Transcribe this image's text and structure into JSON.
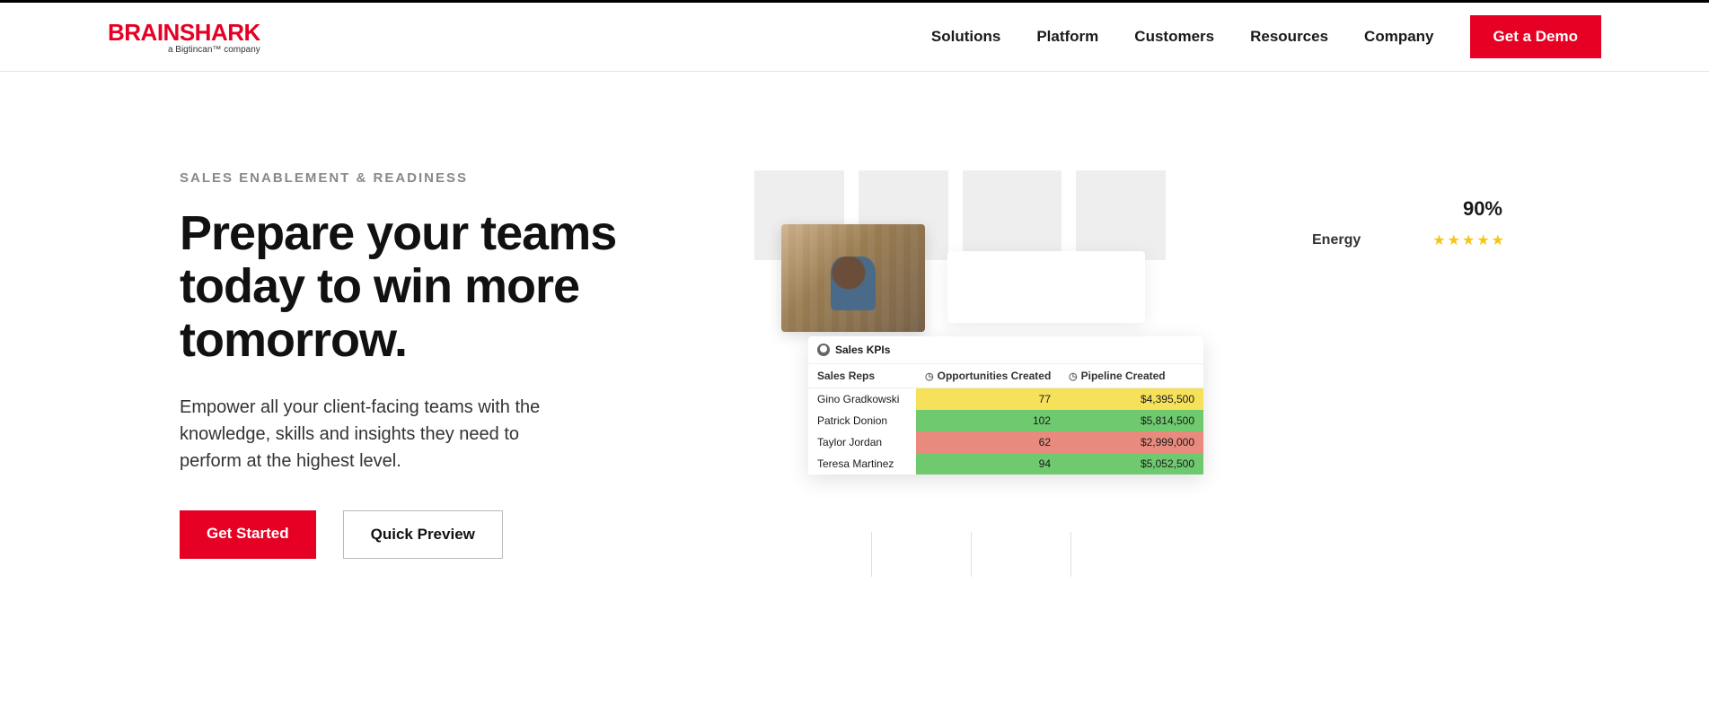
{
  "brand": {
    "name": "BRAINSHARK",
    "tagline": "a Bigtincan™ company"
  },
  "nav": {
    "items": [
      "Solutions",
      "Platform",
      "Customers",
      "Resources",
      "Company"
    ],
    "cta": "Get a Demo"
  },
  "hero": {
    "eyebrow": "SALES ENABLEMENT & READINESS",
    "headline": "Prepare your teams today to win more tomorrow.",
    "subcopy": "Empower all your client-facing teams with the knowledge, skills and insights they need to perform at the highest level.",
    "primary_cta": "Get Started",
    "secondary_cta": "Quick Preview"
  },
  "widget": {
    "score_pct": "90%",
    "metric_label": "Energy",
    "kpi_title": "Sales KPIs",
    "columns": [
      "Sales Reps",
      "Opportunities Created",
      "Pipeline Created"
    ],
    "rows": [
      {
        "name": "Gino Gradkowski",
        "opps": "77",
        "pipe": "$4,395,500",
        "color1": "c-yellow",
        "color2": "c-yellow"
      },
      {
        "name": "Patrick Donion",
        "opps": "102",
        "pipe": "$5,814,500",
        "color1": "c-green",
        "color2": "c-green"
      },
      {
        "name": "Taylor Jordan",
        "opps": "62",
        "pipe": "$2,999,000",
        "color1": "c-red",
        "color2": "c-red"
      },
      {
        "name": "Teresa Martinez",
        "opps": "94",
        "pipe": "$5,052,500",
        "color1": "c-green",
        "color2": "c-green"
      }
    ]
  }
}
